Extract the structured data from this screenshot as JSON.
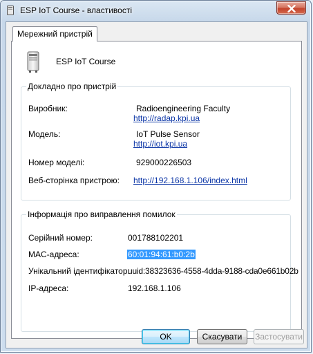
{
  "window": {
    "title": "ESP IoT Course - властивості"
  },
  "tabs": [
    {
      "label": "Мережний пристрій"
    }
  ],
  "device": {
    "name": "ESP IoT Course"
  },
  "details": {
    "title": "Докладно про пристрій",
    "manufacturer_label": "Виробник:",
    "manufacturer_value": "Radioengineering Faculty",
    "manufacturer_link": "http://radap.kpi.ua",
    "model_label": "Модель:",
    "model_value": "IoT Pulse Sensor",
    "model_link": "http://iot.kpi.ua",
    "model_number_label": "Номер моделі:",
    "model_number_value": "929000226503",
    "webpage_label": "Веб-сторінка пристрою:",
    "webpage_link": "http://192.168.1.106/index.html"
  },
  "troubleshooting": {
    "title": "Інформація про виправлення помилок",
    "serial_label": "Серійний номер:",
    "serial_value": "001788102201",
    "mac_label": "MAC-адреса:",
    "mac_value": "60:01:94:61:b0:2b",
    "uid_label": "Унікальний ідентифікатор:",
    "uid_value": "uuid:38323636-4558-4dda-9188-cda0e661b02b",
    "ip_label": "IP-адреса:",
    "ip_value": "192.168.1.106"
  },
  "buttons": {
    "ok": "OK",
    "cancel": "Скасувати",
    "apply": "Застосувати"
  }
}
